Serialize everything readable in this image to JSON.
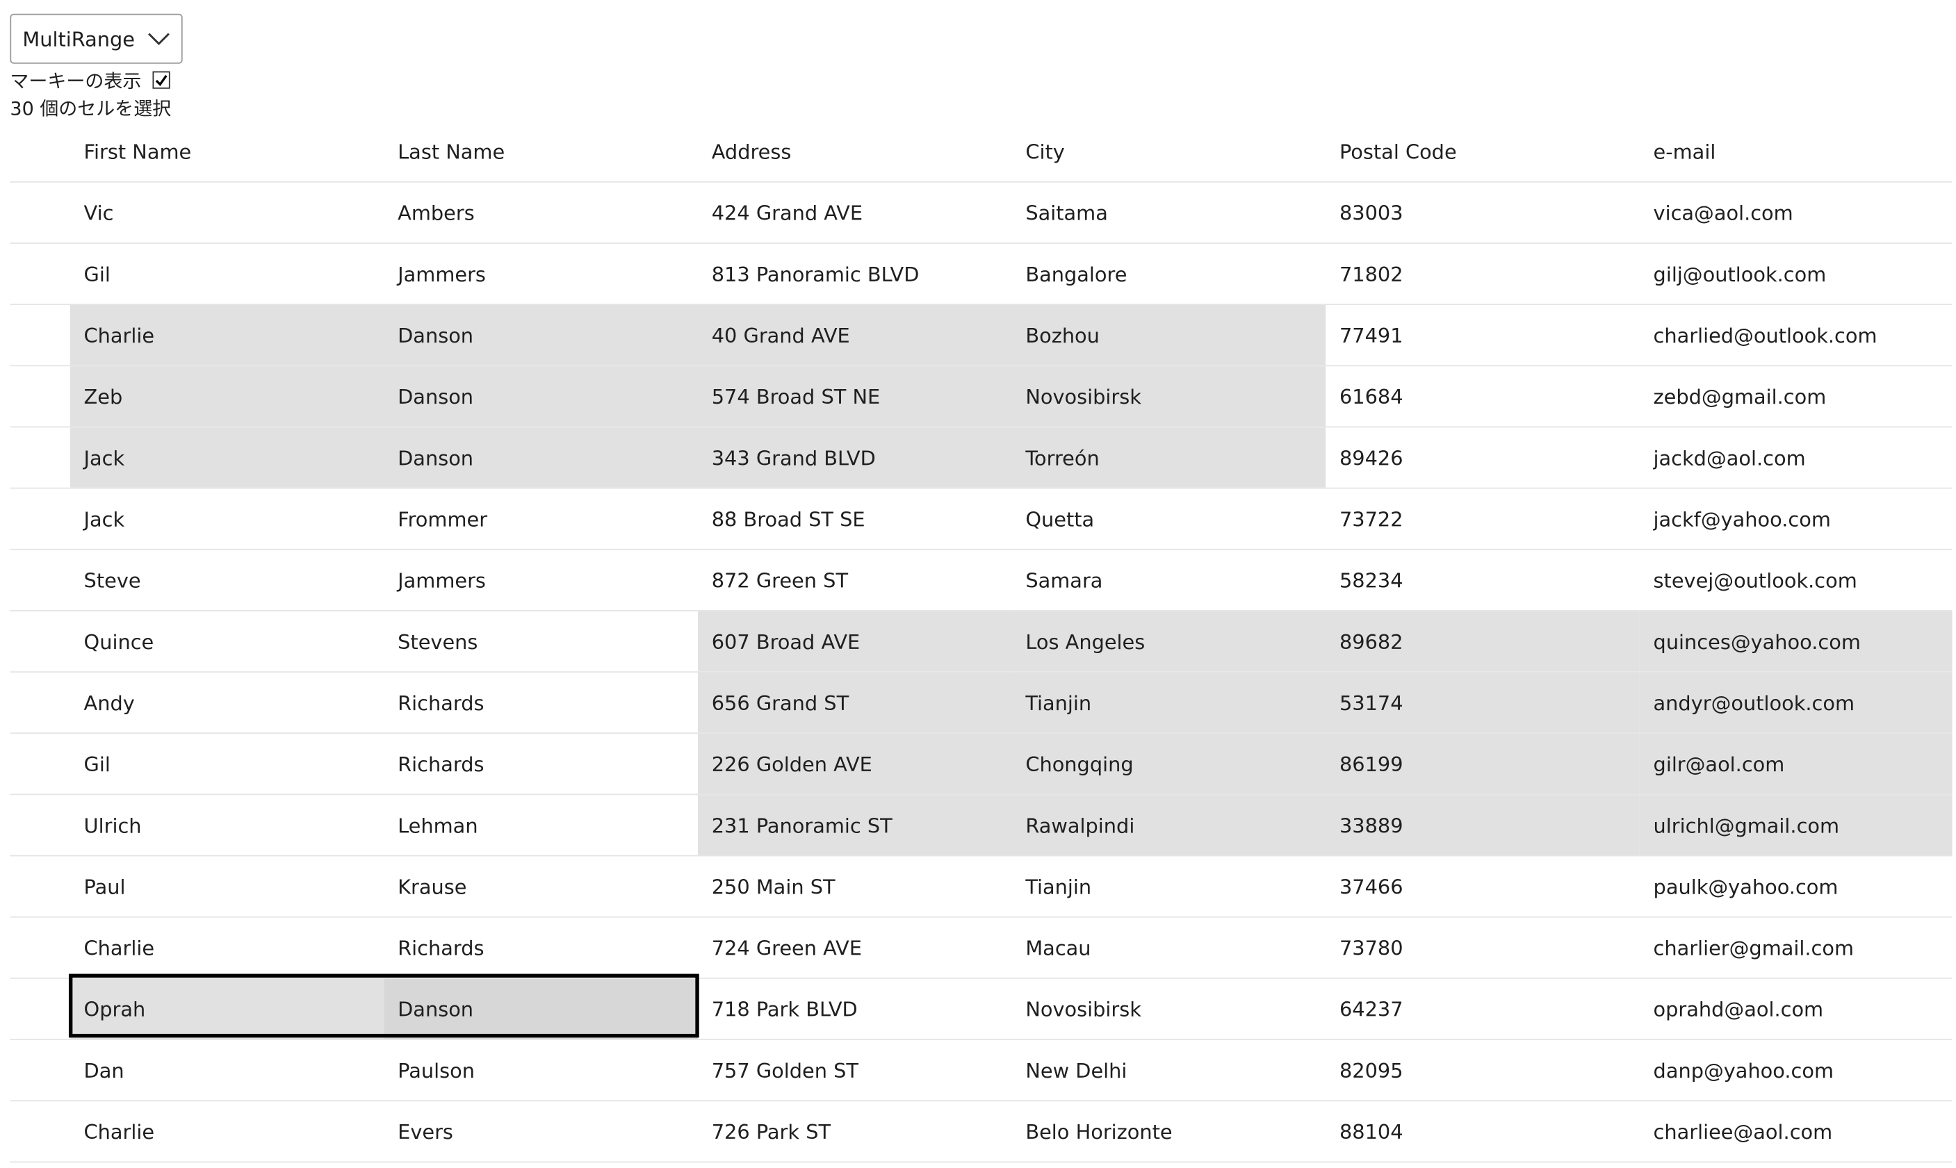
{
  "selection_mode": {
    "value": "MultiRange",
    "icon": "chevron-down-icon"
  },
  "marquee": {
    "label": "マーキーの表示",
    "checked": true,
    "icon": "checkmark-icon"
  },
  "status_text": "30 個のセルを選択",
  "grid": {
    "columns": [
      "First Name",
      "Last Name",
      "Address",
      "City",
      "Postal Code",
      "e-mail"
    ],
    "rows": [
      [
        "Vic",
        "Ambers",
        "424 Grand AVE",
        "Saitama",
        "83003",
        "vica@aol.com"
      ],
      [
        "Gil",
        "Jammers",
        "813 Panoramic BLVD",
        "Bangalore",
        "71802",
        "gilj@outlook.com"
      ],
      [
        "Charlie",
        "Danson",
        "40 Grand AVE",
        "Bozhou",
        "77491",
        "charlied@outlook.com"
      ],
      [
        "Zeb",
        "Danson",
        "574 Broad ST NE",
        "Novosibirsk",
        "61684",
        "zebd@gmail.com"
      ],
      [
        "Jack",
        "Danson",
        "343 Grand BLVD",
        "Torreón",
        "89426",
        "jackd@aol.com"
      ],
      [
        "Jack",
        "Frommer",
        "88 Broad ST SE",
        "Quetta",
        "73722",
        "jackf@yahoo.com"
      ],
      [
        "Steve",
        "Jammers",
        "872 Green ST",
        "Samara",
        "58234",
        "stevej@outlook.com"
      ],
      [
        "Quince",
        "Stevens",
        "607 Broad AVE",
        "Los Angeles",
        "89682",
        "quinces@yahoo.com"
      ],
      [
        "Andy",
        "Richards",
        "656 Grand ST",
        "Tianjin",
        "53174",
        "andyr@outlook.com"
      ],
      [
        "Gil",
        "Richards",
        "226 Golden AVE",
        "Chongqing",
        "86199",
        "gilr@aol.com"
      ],
      [
        "Ulrich",
        "Lehman",
        "231 Panoramic ST",
        "Rawalpindi",
        "33889",
        "ulrichl@gmail.com"
      ],
      [
        "Paul",
        "Krause",
        "250 Main ST",
        "Tianjin",
        "37466",
        "paulk@yahoo.com"
      ],
      [
        "Charlie",
        "Richards",
        "724 Green AVE",
        "Macau",
        "73780",
        "charlier@gmail.com"
      ],
      [
        "Oprah",
        "Danson",
        "718 Park BLVD",
        "Novosibirsk",
        "64237",
        "oprahd@aol.com"
      ],
      [
        "Dan",
        "Paulson",
        "757 Golden ST",
        "New Delhi",
        "82095",
        "danp@yahoo.com"
      ],
      [
        "Charlie",
        "Evers",
        "726 Park ST",
        "Belo Horizonte",
        "88104",
        "charliee@aol.com"
      ]
    ],
    "selected_ranges": [
      {
        "row_start": 2,
        "row_end": 4,
        "col_start": 0,
        "col_end": 3
      },
      {
        "row_start": 7,
        "row_end": 10,
        "col_start": 2,
        "col_end": 5
      },
      {
        "row_start": 13,
        "row_end": 13,
        "col_start": 0,
        "col_end": 1
      }
    ],
    "current_cell": {
      "row": 13,
      "col": 1
    },
    "selection_color": "#e1e1e1",
    "current_cell_color": "#d7d7d7",
    "marquee_color": "#000000"
  }
}
